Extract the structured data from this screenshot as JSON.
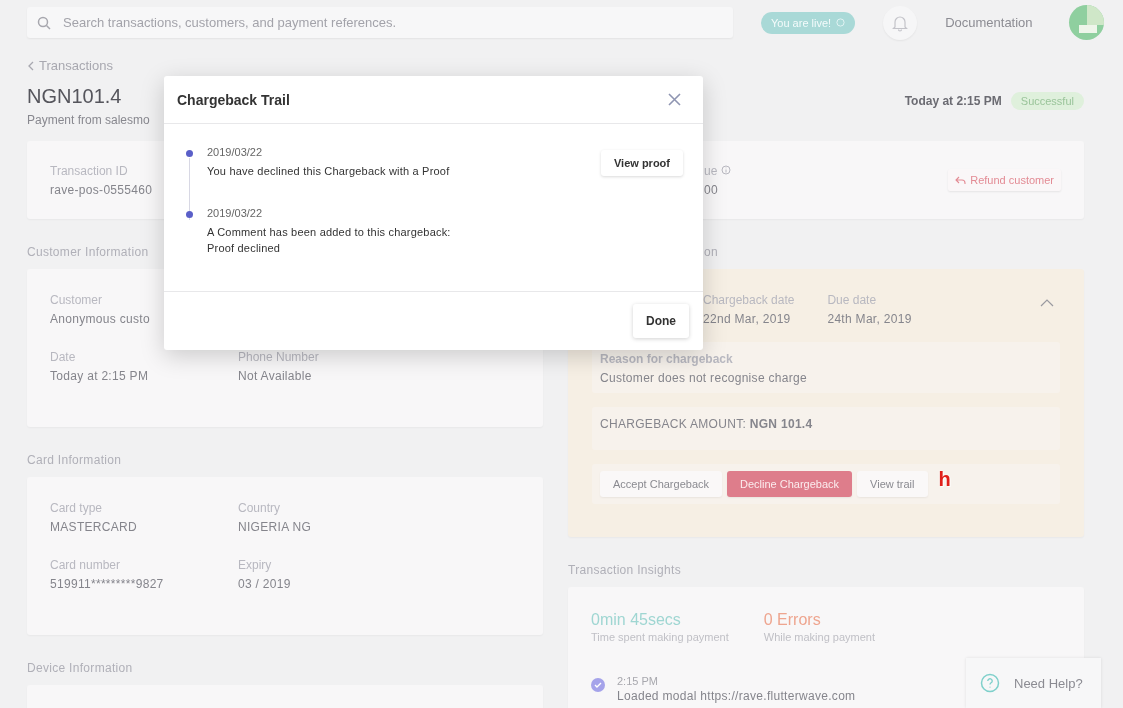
{
  "search": {
    "placeholder": "Search transactions, customers, and payment references."
  },
  "live_badge": {
    "label": "You are live!"
  },
  "nav_link": "Documentation",
  "breadcrumb": "Transactions",
  "header": {
    "amount": "NGN101.4",
    "subtitle": "Payment from salesmo",
    "time": "Today at 2:15 PM",
    "status": "Successful"
  },
  "transaction_card": {
    "label": "Transaction ID",
    "value": "rave-pos-0555460",
    "due_label": "ue",
    "due_value": "00",
    "refund_button": "Refund customer"
  },
  "left_sections": [
    {
      "title": "Customer Information",
      "rows": [
        [
          {
            "label": "Customer",
            "value": "Anonymous custo"
          }
        ],
        [
          {
            "label": "Date",
            "value": "Today at 2:15 PM"
          },
          {
            "label": "Phone Number",
            "value": "Not Available"
          }
        ]
      ]
    },
    {
      "title": "Card Information",
      "rows": [
        [
          {
            "label": "Card type",
            "value": "MASTERCARD"
          },
          {
            "label": "Country",
            "value": "NIGERIA NG"
          }
        ],
        [
          {
            "label": "Card number",
            "value": "519911*********9827"
          },
          {
            "label": "Expiry",
            "value": "03 / 2019"
          }
        ]
      ]
    },
    {
      "title": "Device Information"
    }
  ],
  "chargeback": {
    "heading": "on",
    "expanded": true,
    "fields": [
      {
        "label": "Chargeback date",
        "value": "22nd Mar, 2019"
      },
      {
        "label": "Due date",
        "value": "24th Mar, 2019"
      }
    ],
    "reason_label": "Reason for chargeback",
    "reason": "Customer does not recognise charge",
    "amount": "CHARGEBACK AMOUNT: **NGN 101.4**",
    "buttons": [
      {
        "label": "Accept Chargeback",
        "kind": "plain"
      },
      {
        "label": "Decline Chargeback",
        "kind": "danger"
      },
      {
        "label": "View trail",
        "kind": "plain"
      }
    ],
    "annotation": "h"
  },
  "insights": {
    "title": "Transaction Insights",
    "time": "0min 45secs",
    "time_caption": "Time spent making payment",
    "errors": "0 Errors",
    "errors_caption": "While making payment",
    "events": [
      {
        "time": "2:15 PM",
        "text": "Loaded modal https://rave.flutterwave.com"
      }
    ]
  },
  "help": {
    "label": "Need Help?"
  },
  "modal": {
    "title": "Chargeback Trail",
    "items": [
      {
        "date": "2019/03/22",
        "lines": [
          "You have declined this Chargeback with a Proof"
        ],
        "action": "View proof"
      },
      {
        "date": "2019/03/22",
        "lines": [
          "A Comment has been added to this chargeback:",
          "Proof declined"
        ]
      }
    ],
    "done": "Done"
  }
}
